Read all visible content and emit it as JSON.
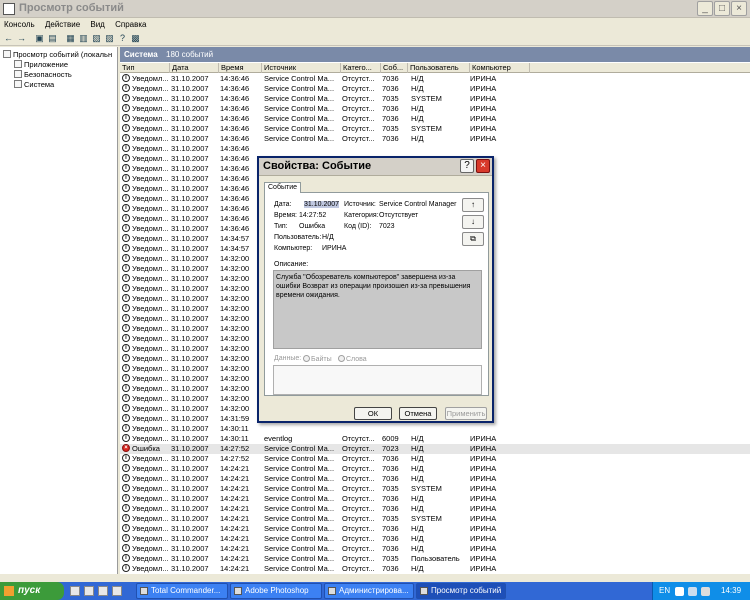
{
  "window": {
    "title": "Просмотр событий"
  },
  "menu": [
    "Консоль",
    "Действие",
    "Вид",
    "Справка"
  ],
  "tree": {
    "root": "Просмотр событий (локальн",
    "items": [
      "Приложение",
      "Безопасность",
      "Система"
    ]
  },
  "list": {
    "section": "Система",
    "count": "180 событий",
    "columns": [
      "Тип",
      "Дата",
      "Время",
      "Источник",
      "Катего...",
      "Соб...",
      "Пользователь",
      "Компьютер"
    ],
    "rows": [
      [
        "Уведомл...",
        "31.10.2007",
        "14:36:46",
        "Service Control Ma...",
        "Отсутст...",
        "7036",
        "Н/Д",
        "ИРИНА"
      ],
      [
        "Уведомл...",
        "31.10.2007",
        "14:36:46",
        "Service Control Ma...",
        "Отсутст...",
        "7036",
        "Н/Д",
        "ИРИНА"
      ],
      [
        "Уведомл...",
        "31.10.2007",
        "14:36:46",
        "Service Control Ma...",
        "Отсутст...",
        "7035",
        "SYSTEM",
        "ИРИНА"
      ],
      [
        "Уведомл...",
        "31.10.2007",
        "14:36:46",
        "Service Control Ma...",
        "Отсутст...",
        "7036",
        "Н/Д",
        "ИРИНА"
      ],
      [
        "Уведомл...",
        "31.10.2007",
        "14:36:46",
        "Service Control Ma...",
        "Отсутст...",
        "7036",
        "Н/Д",
        "ИРИНА"
      ],
      [
        "Уведомл...",
        "31.10.2007",
        "14:36:46",
        "Service Control Ma...",
        "Отсутст...",
        "7035",
        "SYSTEM",
        "ИРИНА"
      ],
      [
        "Уведомл...",
        "31.10.2007",
        "14:36:46",
        "Service Control Ma...",
        "Отсутст...",
        "7036",
        "Н/Д",
        "ИРИНА"
      ],
      [
        "Уведомл...",
        "31.10.2007",
        "14:36:46",
        "",
        "",
        "",
        "",
        ""
      ],
      [
        "Уведомл...",
        "31.10.2007",
        "14:36:46",
        "",
        "",
        "",
        "",
        ""
      ],
      [
        "Уведомл...",
        "31.10.2007",
        "14:36:46",
        "",
        "",
        "",
        "",
        ""
      ],
      [
        "Уведомл...",
        "31.10.2007",
        "14:36:46",
        "",
        "",
        "",
        "",
        ""
      ],
      [
        "Уведомл...",
        "31.10.2007",
        "14:36:46",
        "",
        "",
        "",
        "",
        ""
      ],
      [
        "Уведомл...",
        "31.10.2007",
        "14:36:46",
        "",
        "",
        "",
        "",
        ""
      ],
      [
        "Уведомл...",
        "31.10.2007",
        "14:36:46",
        "",
        "",
        "",
        "",
        ""
      ],
      [
        "Уведомл...",
        "31.10.2007",
        "14:36:46",
        "",
        "",
        "",
        "",
        ""
      ],
      [
        "Уведомл...",
        "31.10.2007",
        "14:36:46",
        "",
        "",
        "",
        "",
        ""
      ],
      [
        "Уведомл...",
        "31.10.2007",
        "14:34:57",
        "",
        "",
        "",
        "",
        ""
      ],
      [
        "Уведомл...",
        "31.10.2007",
        "14:34:57",
        "",
        "",
        "",
        "",
        ""
      ],
      [
        "Уведомл...",
        "31.10.2007",
        "14:32:00",
        "",
        "",
        "",
        "",
        ""
      ],
      [
        "Уведомл...",
        "31.10.2007",
        "14:32:00",
        "",
        "",
        "",
        "",
        ""
      ],
      [
        "Уведомл...",
        "31.10.2007",
        "14:32:00",
        "",
        "",
        "",
        "",
        ""
      ],
      [
        "Уведомл...",
        "31.10.2007",
        "14:32:00",
        "",
        "",
        "",
        "",
        ""
      ],
      [
        "Уведомл...",
        "31.10.2007",
        "14:32:00",
        "",
        "",
        "",
        "",
        ""
      ],
      [
        "Уведомл...",
        "31.10.2007",
        "14:32:00",
        "",
        "",
        "",
        "",
        ""
      ],
      [
        "Уведомл...",
        "31.10.2007",
        "14:32:00",
        "",
        "",
        "",
        "",
        ""
      ],
      [
        "Уведомл...",
        "31.10.2007",
        "14:32:00",
        "",
        "",
        "",
        "",
        ""
      ],
      [
        "Уведомл...",
        "31.10.2007",
        "14:32:00",
        "",
        "",
        "",
        "",
        ""
      ],
      [
        "Уведомл...",
        "31.10.2007",
        "14:32:00",
        "",
        "",
        "",
        "",
        ""
      ],
      [
        "Уведомл...",
        "31.10.2007",
        "14:32:00",
        "",
        "",
        "",
        "",
        ""
      ],
      [
        "Уведомл...",
        "31.10.2007",
        "14:32:00",
        "",
        "",
        "",
        "",
        ""
      ],
      [
        "Уведомл...",
        "31.10.2007",
        "14:32:00",
        "",
        "",
        "",
        "",
        ""
      ],
      [
        "Уведомл...",
        "31.10.2007",
        "14:32:00",
        "",
        "",
        "",
        "",
        ""
      ],
      [
        "Уведомл...",
        "31.10.2007",
        "14:32:00",
        "",
        "",
        "",
        "",
        ""
      ],
      [
        "Уведомл...",
        "31.10.2007",
        "14:32:00",
        "",
        "",
        "",
        "",
        ""
      ],
      [
        "Уведомл...",
        "31.10.2007",
        "14:31:59",
        "",
        "",
        "",
        "",
        ""
      ],
      [
        "Уведомл...",
        "31.10.2007",
        "14:30:11",
        "",
        "",
        "",
        "",
        ""
      ],
      [
        "Уведомл...",
        "31.10.2007",
        "14:30:11",
        "eventlog",
        "Отсутст...",
        "6009",
        "Н/Д",
        "ИРИНА"
      ],
      [
        "Ошибка",
        "31.10.2007",
        "14:27:52",
        "Service Control Ma...",
        "Отсутст...",
        "7023",
        "Н/Д",
        "ИРИНА"
      ],
      [
        "Уведомл...",
        "31.10.2007",
        "14:27:52",
        "Service Control Ma...",
        "Отсутст...",
        "7036",
        "Н/Д",
        "ИРИНА"
      ],
      [
        "Уведомл...",
        "31.10.2007",
        "14:24:21",
        "Service Control Ma...",
        "Отсутст...",
        "7036",
        "Н/Д",
        "ИРИНА"
      ],
      [
        "Уведомл...",
        "31.10.2007",
        "14:24:21",
        "Service Control Ma...",
        "Отсутст...",
        "7036",
        "Н/Д",
        "ИРИНА"
      ],
      [
        "Уведомл...",
        "31.10.2007",
        "14:24:21",
        "Service Control Ma...",
        "Отсутст...",
        "7035",
        "SYSTEM",
        "ИРИНА"
      ],
      [
        "Уведомл...",
        "31.10.2007",
        "14:24:21",
        "Service Control Ma...",
        "Отсутст...",
        "7036",
        "Н/Д",
        "ИРИНА"
      ],
      [
        "Уведомл...",
        "31.10.2007",
        "14:24:21",
        "Service Control Ma...",
        "Отсутст...",
        "7036",
        "Н/Д",
        "ИРИНА"
      ],
      [
        "Уведомл...",
        "31.10.2007",
        "14:24:21",
        "Service Control Ma...",
        "Отсутст...",
        "7035",
        "SYSTEM",
        "ИРИНА"
      ],
      [
        "Уведомл...",
        "31.10.2007",
        "14:24:21",
        "Service Control Ma...",
        "Отсутст...",
        "7036",
        "Н/Д",
        "ИРИНА"
      ],
      [
        "Уведомл...",
        "31.10.2007",
        "14:24:21",
        "Service Control Ma...",
        "Отсутст...",
        "7036",
        "Н/Д",
        "ИРИНА"
      ],
      [
        "Уведомл...",
        "31.10.2007",
        "14:24:21",
        "Service Control Ma...",
        "Отсутст...",
        "7036",
        "Н/Д",
        "ИРИНА"
      ],
      [
        "Уведомл...",
        "31.10.2007",
        "14:24:21",
        "Service Control Ma...",
        "Отсутст...",
        "7035",
        "Пользователь",
        "ИРИНА"
      ],
      [
        "Уведомл...",
        "31.10.2007",
        "14:24:21",
        "Service Control Ma...",
        "Отсутст...",
        "7036",
        "Н/Д",
        "ИРИНА"
      ],
      [
        "Уведомл...",
        "31.10.2007",
        "14:24:21",
        "Service Control Ma...",
        "Отсутст...",
        "7036",
        "Н/Д",
        "ИРИНА"
      ]
    ]
  },
  "dialog": {
    "title": "Свойства: Событие",
    "tab": "Событие",
    "date_label": "Дата:",
    "date": "31.10.2007",
    "source_label": "Источник:",
    "source": "Service Control Manager",
    "time_label": "Время:",
    "time": "14:27:52",
    "category_label": "Категория:",
    "category": "Отсутствует",
    "type_label": "Тип:",
    "type": "Ошибка",
    "code_label": "Код (ID):",
    "code": "7023",
    "user_label": "Пользователь:",
    "user": "Н/Д",
    "computer_label": "Компьютер:",
    "computer": "ИРИНА",
    "description_label": "Описание:",
    "description": "Служба \"Обозреватель компьютеров\" завершена из-за ошибки Возврат из операции произошел из-за превышения времени ожидания.",
    "data_label": "Данные:",
    "bytes_label": "Байты",
    "words_label": "Слова",
    "ok": "ОК",
    "cancel": "Отмена",
    "apply": "Применить"
  },
  "taskbar": {
    "start": "пуск",
    "tasks": [
      "Total Commander...",
      "Adobe Photoshop",
      "Администрирова...",
      "Просмотр событий"
    ],
    "lang": "EN",
    "clock": "14:39"
  },
  "icons": {
    "info": "info-icon",
    "error": "error-icon",
    "arrow_up": "arrow-up-icon",
    "arrow_down": "arrow-down-icon",
    "copy": "copy-icon"
  },
  "colors": {
    "title_active": "#0a246a",
    "error_icon": "#d8261f",
    "taskbar": "#3168d5",
    "start": "#3c9b3a",
    "list_header": "#7a8aa8"
  }
}
